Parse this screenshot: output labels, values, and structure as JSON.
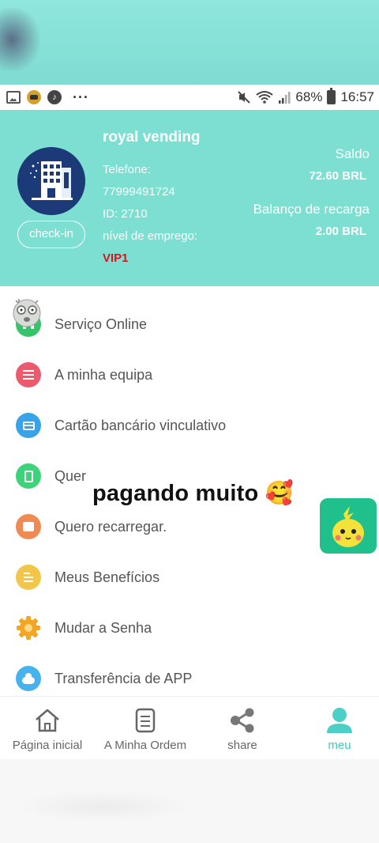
{
  "status_bar": {
    "battery": "68%",
    "time": "16:57",
    "more": "···"
  },
  "profile": {
    "name": "royal vending",
    "phone_label": "Telefone:",
    "phone": "77999491724",
    "id": "ID: 2710",
    "level_label": "nível de emprego:",
    "level": "VIP1",
    "checkin_label": "check-in",
    "saldo_label": "Saldo",
    "saldo_value": "72.60  BRL",
    "recharge_label": "Balanço de recarga",
    "recharge_value": "2.00  BRL"
  },
  "menu": {
    "items": [
      {
        "label": "Serviço Online",
        "icon": "headset-icon",
        "color": "#36c46a"
      },
      {
        "label": "A minha equipa",
        "icon": "list-icon",
        "color": "#ec5a6e"
      },
      {
        "label": "Cartão bancário vinculativo",
        "icon": "card-icon",
        "color": "#3aa2e6"
      },
      {
        "label": "Quer",
        "icon": "phone-icon",
        "color": "#3ed27a"
      },
      {
        "label": "Quero recarregar.",
        "icon": "wallet-icon",
        "color": "#f08a53"
      },
      {
        "label": "Meus Benefícios",
        "icon": "benefits-icon",
        "color": "#f2c64a"
      },
      {
        "label": "Mudar a Senha",
        "icon": "gear-icon",
        "color": "#f3a524"
      },
      {
        "label": "Transferência de APP",
        "icon": "cloud-icon",
        "color": "#46b3ee"
      }
    ]
  },
  "overlay": {
    "text": "pagando muito 🥰"
  },
  "bottom_nav": {
    "items": [
      {
        "label": "Página inicial",
        "icon": "home-icon",
        "active": false
      },
      {
        "label": "A Minha Ordem",
        "icon": "document-icon",
        "active": false
      },
      {
        "label": "share",
        "icon": "share-icon",
        "active": false
      },
      {
        "label": "meu",
        "icon": "user-icon",
        "active": true
      }
    ]
  },
  "colors": {
    "header": "#7ddfd2",
    "accent": "#42c7c0",
    "vip": "#d7151a"
  }
}
